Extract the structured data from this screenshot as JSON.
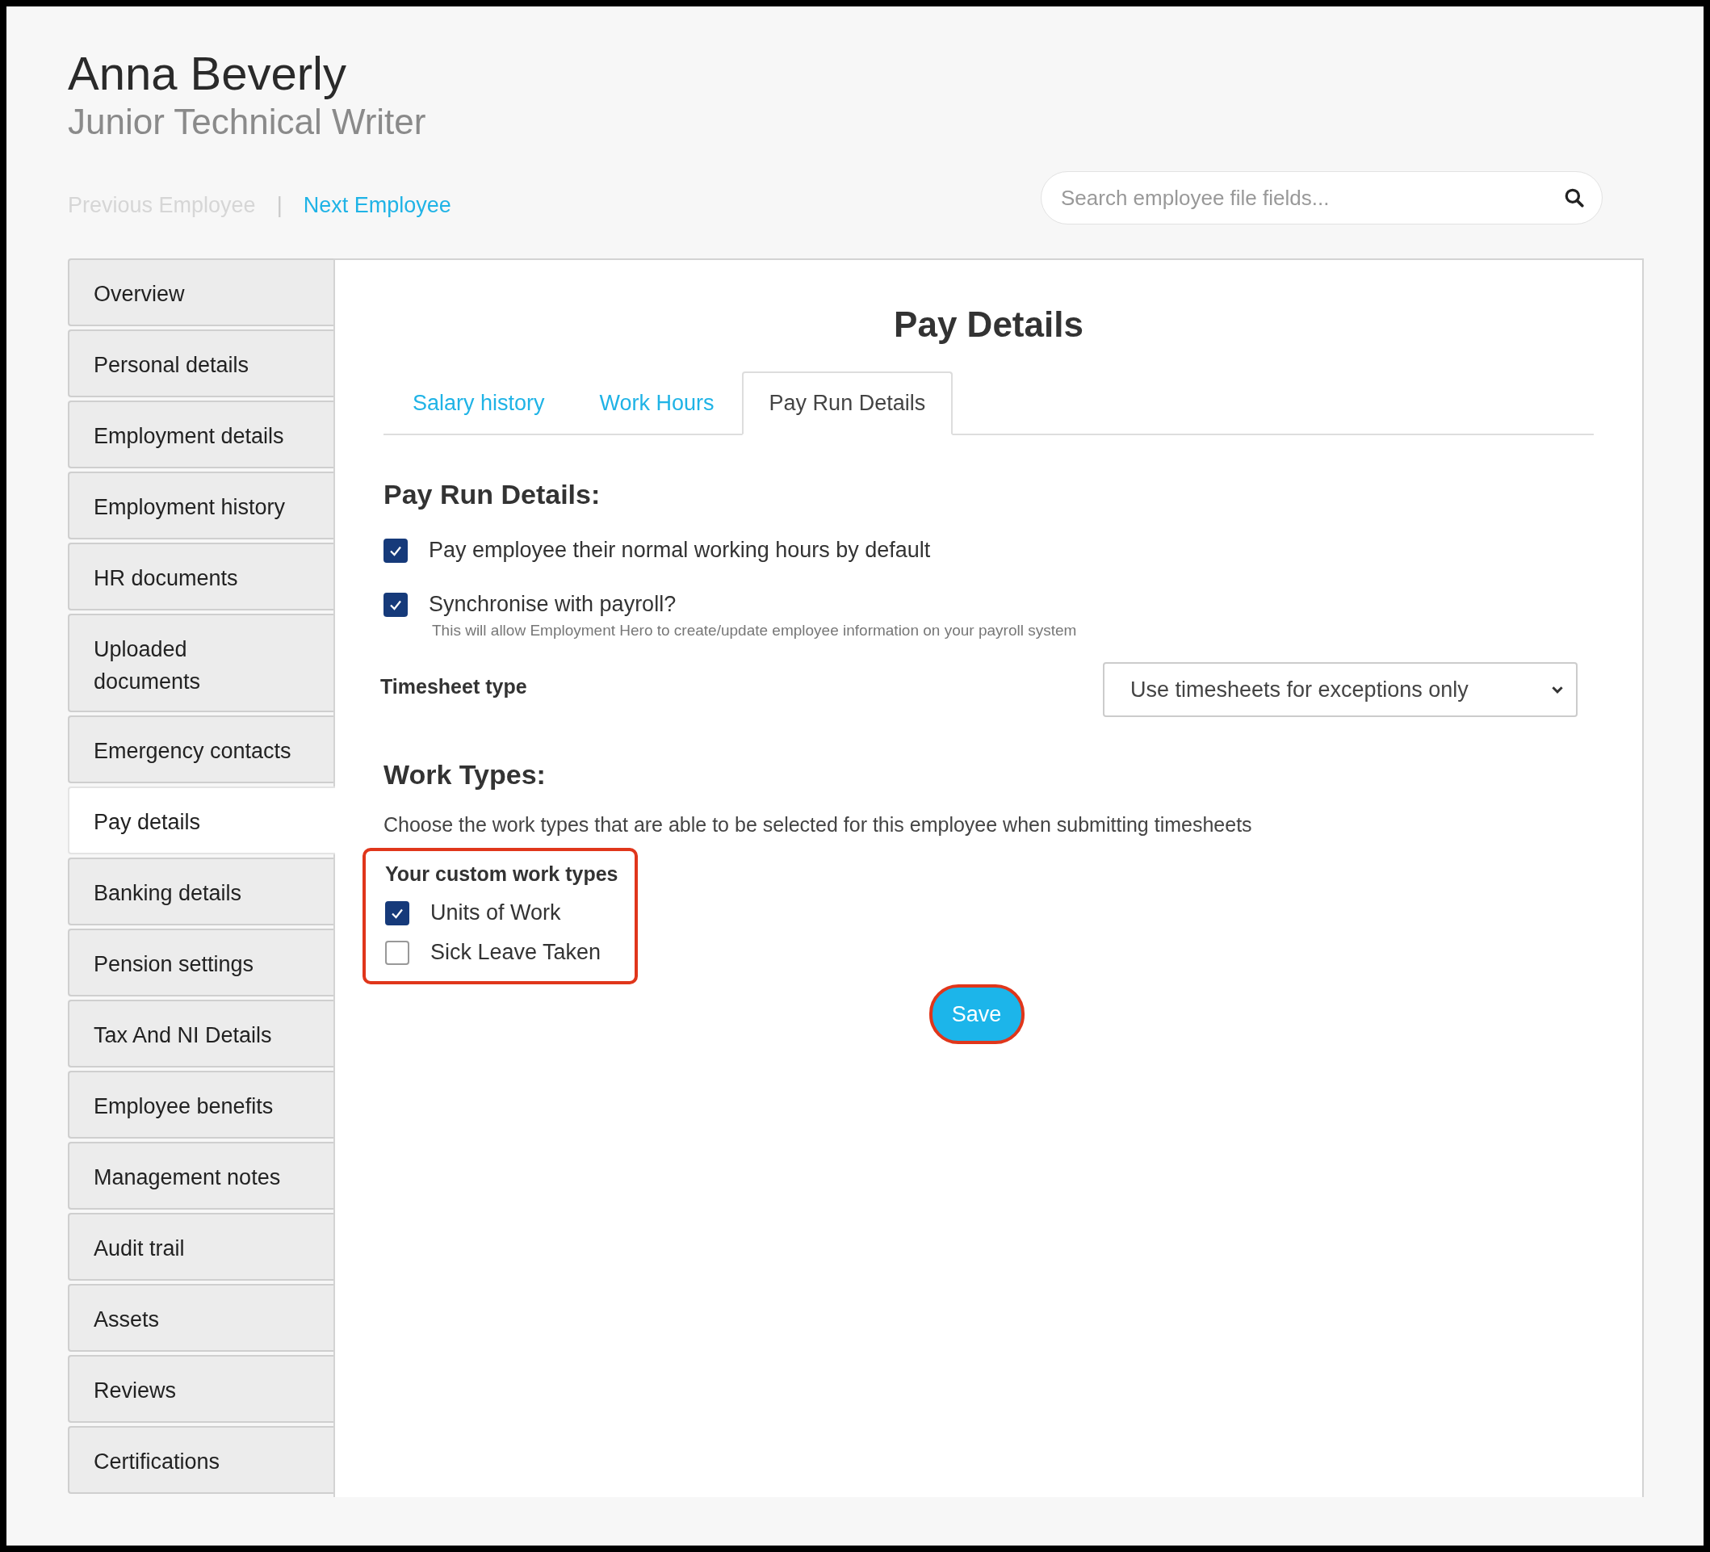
{
  "employee": {
    "name": "Anna Beverly",
    "job_title": "Junior Technical Writer"
  },
  "nav": {
    "previous": {
      "label": "Previous Employee",
      "disabled": true
    },
    "separator": "|",
    "next": {
      "label": "Next Employee",
      "disabled": false
    }
  },
  "search": {
    "placeholder": "Search employee file fields..."
  },
  "sidebar": {
    "items": [
      {
        "label": "Overview",
        "selected": false
      },
      {
        "label": "Personal details",
        "selected": false
      },
      {
        "label": "Employment details",
        "selected": false
      },
      {
        "label": "Employment history",
        "selected": false
      },
      {
        "label": "HR documents",
        "selected": false
      },
      {
        "label": "Uploaded documents",
        "selected": false
      },
      {
        "label": "Emergency contacts",
        "selected": false
      },
      {
        "label": "Pay details",
        "selected": true
      },
      {
        "label": "Banking details",
        "selected": false
      },
      {
        "label": "Pension settings",
        "selected": false
      },
      {
        "label": "Tax And NI Details",
        "selected": false
      },
      {
        "label": "Employee benefits",
        "selected": false
      },
      {
        "label": "Management notes",
        "selected": false
      },
      {
        "label": "Audit trail",
        "selected": false
      },
      {
        "label": "Assets",
        "selected": false
      },
      {
        "label": "Reviews",
        "selected": false
      },
      {
        "label": "Certifications",
        "selected": false
      }
    ]
  },
  "panel": {
    "title": "Pay Details",
    "tabs": [
      {
        "label": "Salary history",
        "selected": false
      },
      {
        "label": "Work Hours",
        "selected": false
      },
      {
        "label": "Pay Run Details",
        "selected": true
      }
    ],
    "pay_run": {
      "heading": "Pay Run Details:",
      "options": [
        {
          "label": "Pay employee their normal working hours by default",
          "checked": true
        },
        {
          "label": "Synchronise with payroll?",
          "checked": true,
          "hint": "This will allow Employment Hero to create/update employee information on your payroll system"
        }
      ],
      "timesheet_type": {
        "label": "Timesheet type",
        "value": "Use timesheets for exceptions only"
      }
    },
    "work_types": {
      "heading": "Work Types:",
      "description": "Choose the work types that are able to be selected for this employee when submitting timesheets",
      "custom": {
        "heading": "Your custom work types",
        "highlighted": true,
        "items": [
          {
            "label": "Units of Work",
            "checked": true
          },
          {
            "label": "Sick Leave Taken",
            "checked": false
          }
        ]
      }
    },
    "save_button": {
      "label": "Save",
      "highlighted": true
    }
  }
}
